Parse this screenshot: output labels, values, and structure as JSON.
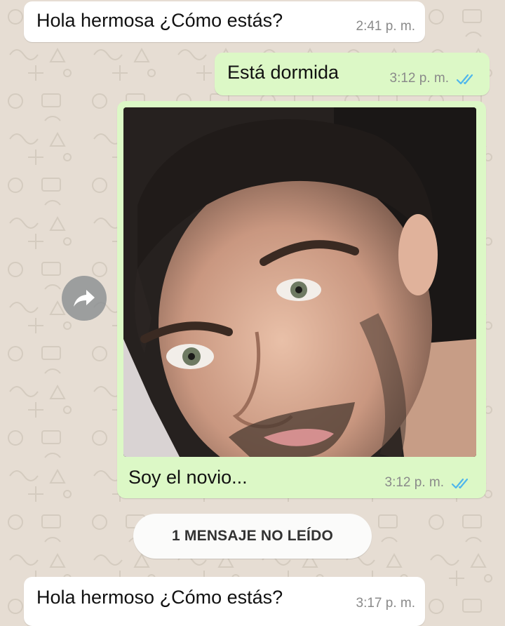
{
  "messages": [
    {
      "direction": "incoming",
      "text": "Hola hermosa ¿Cómo estás?",
      "time": "2:41 p. m."
    },
    {
      "direction": "outgoing",
      "text": "Está dormida",
      "time": "3:12 p. m.",
      "status": "read"
    },
    {
      "direction": "outgoing",
      "type": "image",
      "caption": "Soy el novio...",
      "time": "3:12 p. m.",
      "status": "read"
    },
    {
      "direction": "incoming",
      "text": "Hola hermoso ¿Cómo estás?",
      "time": "3:17 p. m."
    }
  ],
  "unread_banner": "1 MENSAJE NO LEÍDO",
  "icons": {
    "read_ticks": "double-check-icon",
    "forward": "forward-arrow-icon"
  },
  "colors": {
    "wallpaper": "#e6ddd3",
    "incoming_bubble": "#ffffff",
    "outgoing_bubble": "#dcf8c6",
    "read_ticks": "#4fb6ec",
    "timestamp": "#8a8a8a"
  }
}
